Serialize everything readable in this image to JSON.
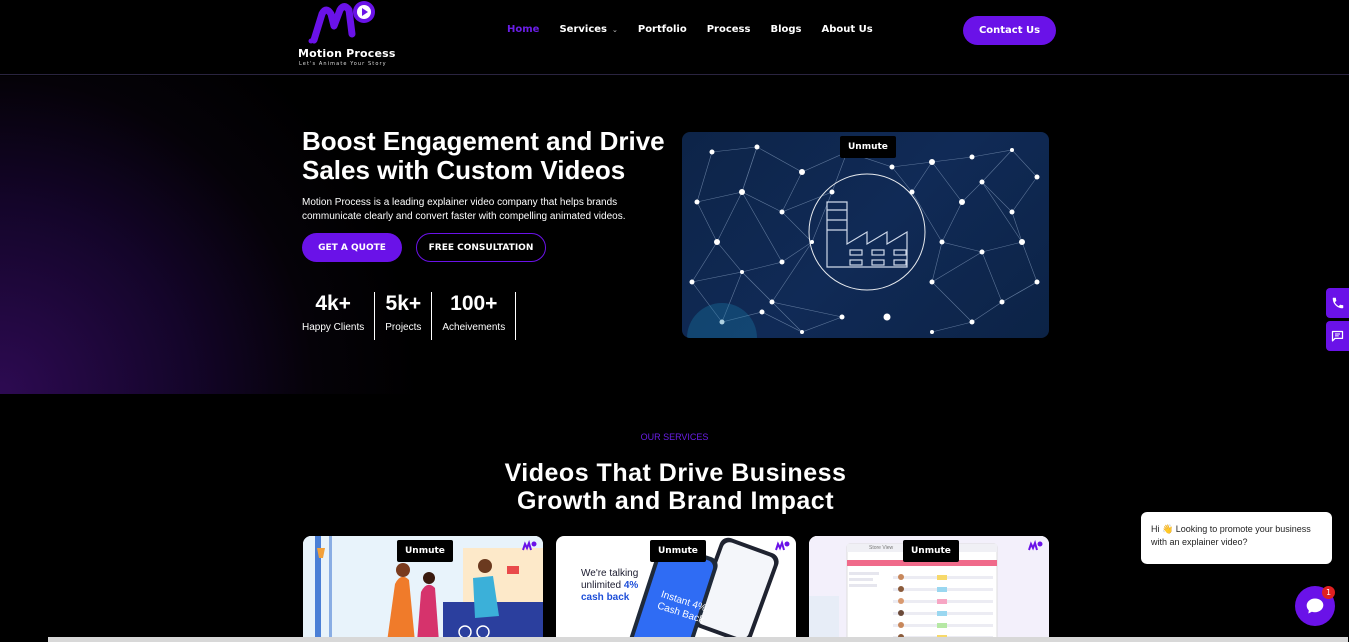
{
  "brand": {
    "name": "Motion Process",
    "tagline": "Let's Animate Your Story"
  },
  "nav": {
    "items": [
      {
        "label": "Home",
        "active": true
      },
      {
        "label": "Services",
        "has_dropdown": true
      },
      {
        "label": "Portfolio"
      },
      {
        "label": "Process"
      },
      {
        "label": "Blogs"
      },
      {
        "label": "About Us"
      }
    ],
    "cta": "Contact Us"
  },
  "hero": {
    "title": "Boost Engagement and Drive Sales with Custom Videos",
    "description": "Motion Process is a leading explainer video company that helps brands communicate clearly and convert faster with compelling animated videos.",
    "primary_button": "GET A QUOTE",
    "secondary_button": "FREE CONSULTATION",
    "stats": [
      {
        "value": "4k+",
        "label": "Happy Clients"
      },
      {
        "value": "5k+",
        "label": "Projects"
      },
      {
        "value": "100+",
        "label": "Acheivements"
      }
    ],
    "video_button": "Unmute"
  },
  "services": {
    "eyebrow": "OUR SERVICES",
    "title_line1": "Videos That Drive Business",
    "title_line2": "Growth and Brand Impact",
    "cards": [
      {
        "button": "Unmute"
      },
      {
        "button": "Unmute",
        "promo_line1": "We're talking",
        "promo_line2": "unlimited",
        "promo_highlight": "4%",
        "promo_line3": "cash back",
        "phone_text_1": "Instant 4%",
        "phone_text_2": "Cash Back"
      },
      {
        "button": "Unmute",
        "app_title": "Store View"
      }
    ]
  },
  "chat": {
    "message": "Hi 👋 Looking to promote your business with an explainer video?",
    "badge_count": "1"
  },
  "colors": {
    "accent": "#6a12e8",
    "background": "#000000"
  }
}
